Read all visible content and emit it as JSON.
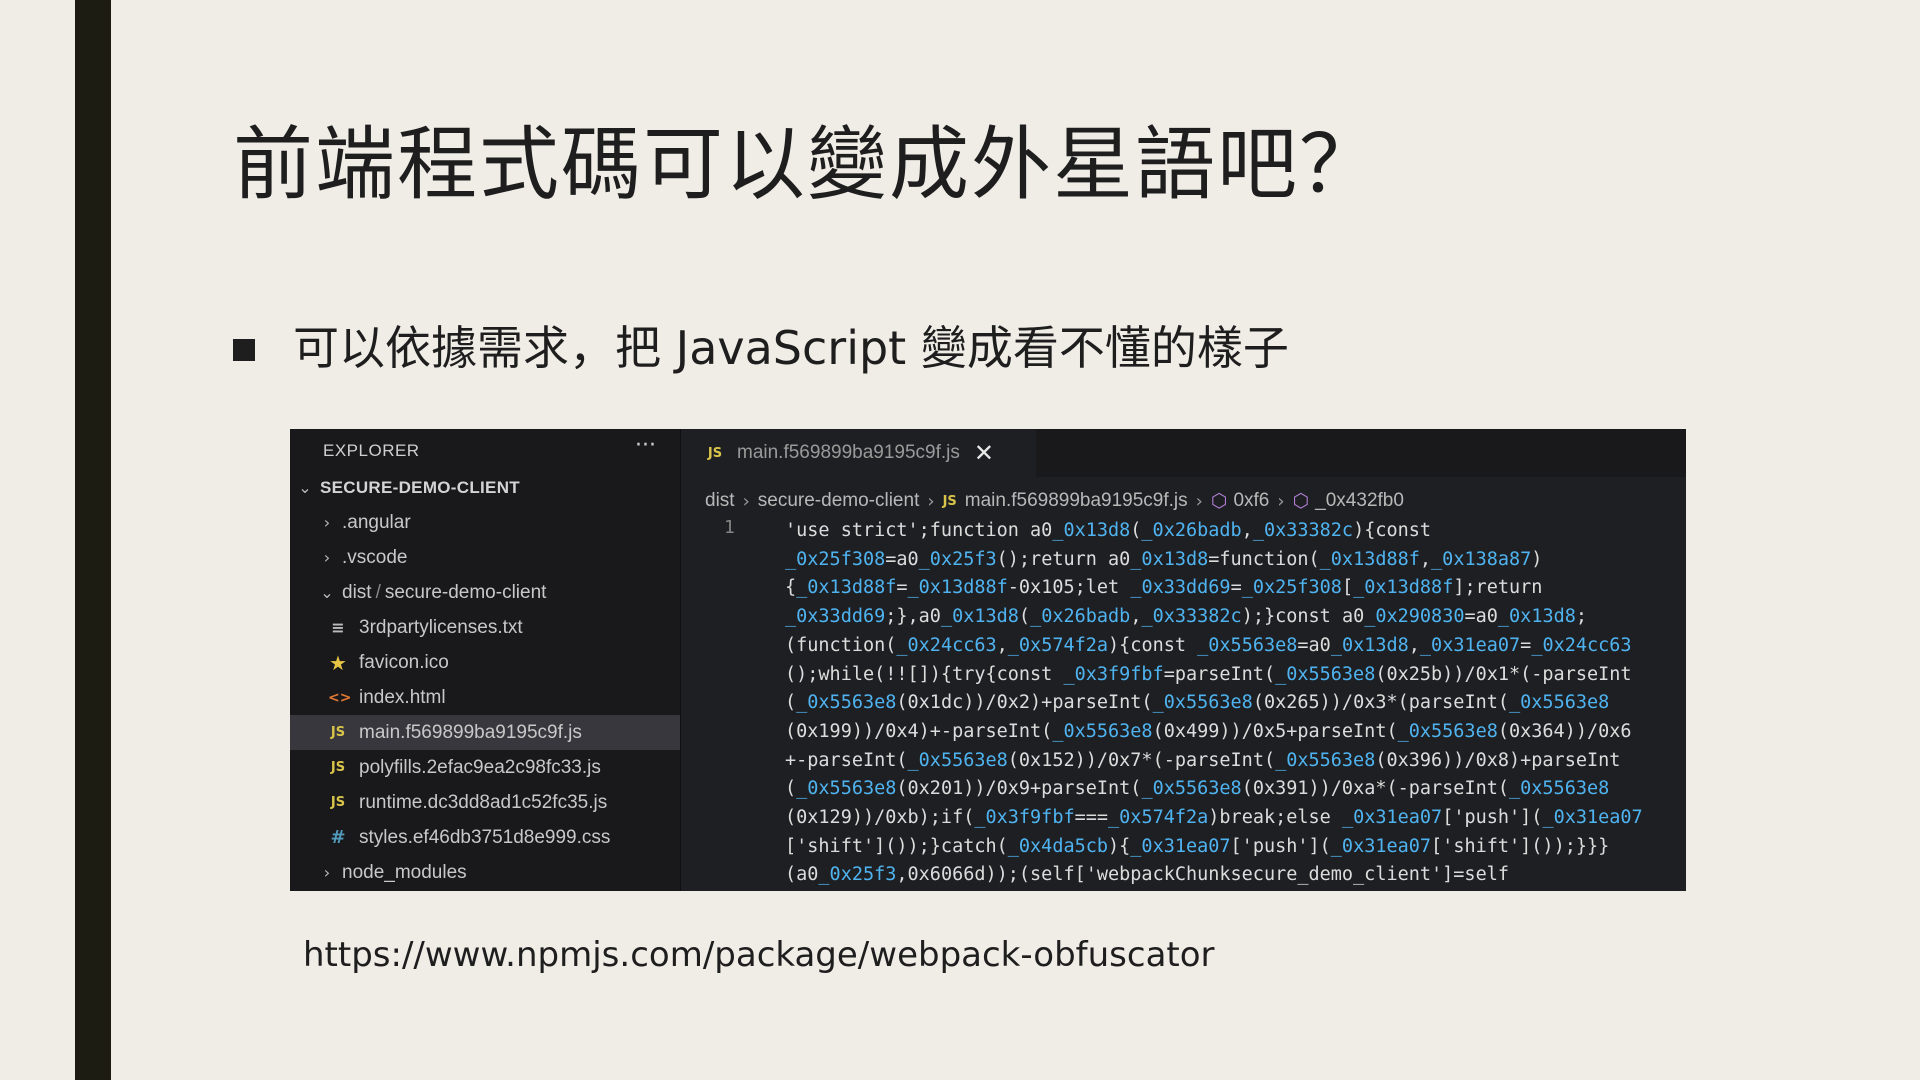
{
  "slide": {
    "title": "前端程式碼可以變成外星語吧？",
    "bullet": "可以依據需求，把 JavaScript 變成看不懂的樣子",
    "url": "https://www.npmjs.com/package/webpack-obfuscator"
  },
  "explorer": {
    "header": "EXPLORER",
    "more": "···",
    "project": "SECURE-DEMO-CLIENT",
    "items": [
      {
        "label": ".angular"
      },
      {
        "label": ".vscode"
      },
      {
        "label_dir": "dist",
        "label_sep": "/",
        "label_sub": "secure-demo-client"
      },
      {
        "label": "3rdpartylicenses.txt",
        "icon": "text-file-icon"
      },
      {
        "label": "favicon.ico",
        "icon": "star-icon"
      },
      {
        "label": "index.html",
        "icon": "html-icon"
      },
      {
        "label": "main.f569899ba9195c9f.js",
        "icon": "js-icon"
      },
      {
        "label": "polyfills.2efac9ea2c98fc33.js",
        "icon": "js-icon"
      },
      {
        "label": "runtime.dc3dd8ad1c52fc35.js",
        "icon": "js-icon"
      },
      {
        "label": "styles.ef46db3751d8e999.css",
        "icon": "css-icon"
      },
      {
        "label": "node_modules"
      }
    ]
  },
  "editor": {
    "tab": {
      "label": "main.f569899ba9195c9f.js",
      "icon_text": "JS",
      "close": "✕"
    },
    "breadcrumb": {
      "dist": "dist",
      "folder": "secure-demo-client",
      "file_icon": "JS",
      "file": "main.f569899ba9195c9f.js",
      "symbol1": "0xf6",
      "symbol2": "_0x432fb0"
    },
    "line_number": "1",
    "code_lines": [
      "'use strict';function a0_0x13d8(_0x26badb,_0x33382c){const",
      "_0x25f308=a0_0x25f3();return a0_0x13d8=function(_0x13d88f,_0x138a87)",
      "{_0x13d88f=_0x13d88f-0x105;let _0x33dd69=_0x25f308[_0x13d88f];return",
      "_0x33dd69;},a0_0x13d8(_0x26badb,_0x33382c);}const a0_0x290830=a0_0x13d8;",
      "(function(_0x24cc63,_0x574f2a){const _0x5563e8=a0_0x13d8,_0x31ea07=_0x24cc63",
      "();while(!![]){try{const _0x3f9fbf=parseInt(_0x5563e8(0x25b))/0x1*(-parseInt",
      "(_0x5563e8(0x1dc))/0x2)+parseInt(_0x5563e8(0x265))/0x3*(parseInt(_0x5563e8",
      "(0x199))/0x4)+-parseInt(_0x5563e8(0x499))/0x5+parseInt(_0x5563e8(0x364))/0x6",
      "+-parseInt(_0x5563e8(0x152))/0x7*(-parseInt(_0x5563e8(0x396))/0x8)+parseInt",
      "(_0x5563e8(0x201))/0x9+parseInt(_0x5563e8(0x391))/0xa*(-parseInt(_0x5563e8",
      "(0x129))/0xb);if(_0x3f9fbf===_0x574f2a)break;else _0x31ea07['push'](_0x31ea07",
      "['shift']());}catch(_0x4da5cb){_0x31ea07['push'](_0x31ea07['shift']());}}}",
      "(a0_0x25f3,0x6066d));(self['webpackChunksecure_demo_client']=self"
    ]
  },
  "colors": {
    "slide_bg": "#f0ede7",
    "side_bar": "#1c1c13",
    "editor_bg": "#1e1f22",
    "identifier_blue": "#4fb3f0",
    "js_icon": "#d9c44a"
  }
}
